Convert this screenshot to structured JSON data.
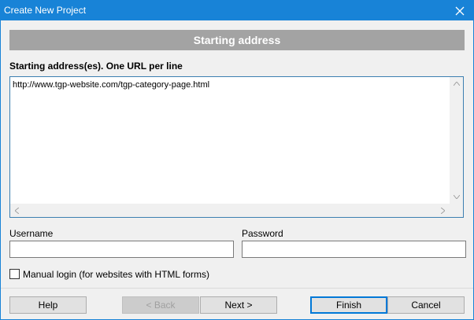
{
  "window": {
    "title": "Create New Project",
    "close_glyph": "✕"
  },
  "banner": {
    "label": "Starting address"
  },
  "addresses": {
    "label": "Starting address(es). One URL per line",
    "value": "http://www.tgp-website.com/tgp-category-page.html"
  },
  "username": {
    "label": "Username",
    "value": ""
  },
  "password": {
    "label": "Password",
    "value": ""
  },
  "manual_login": {
    "label": "Manual login (for websites with HTML forms)",
    "checked": false
  },
  "buttons": {
    "help": "Help",
    "back": "< Back",
    "next": "Next >",
    "finish": "Finish",
    "cancel": "Cancel"
  },
  "icons": {
    "close": "close-icon",
    "scroll_up": "chevron-up-icon",
    "scroll_down": "chevron-down-icon",
    "scroll_left": "chevron-left-icon",
    "scroll_right": "chevron-right-icon"
  },
  "colors": {
    "titlebar": "#1883d7",
    "banner": "#a3a3a3",
    "focus_border": "#0078d7"
  }
}
